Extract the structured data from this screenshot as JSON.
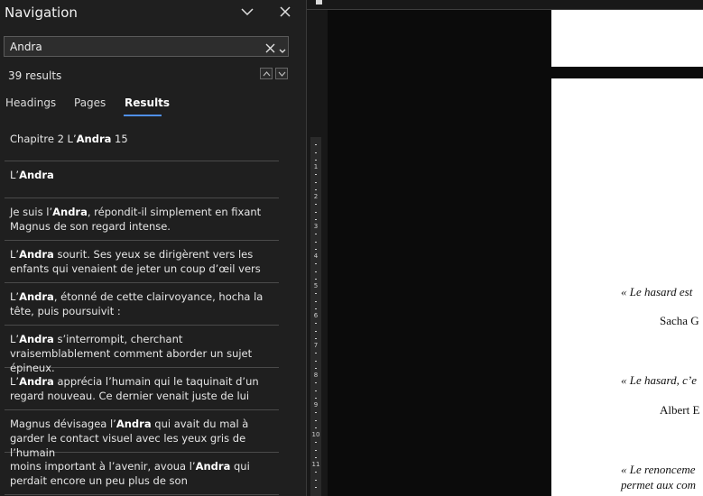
{
  "navigation": {
    "title": "Navigation",
    "search_value": "Andra",
    "results_count": "39 results",
    "tabs": [
      {
        "label": "Headings",
        "active": false
      },
      {
        "label": "Pages",
        "active": false
      },
      {
        "label": "Results",
        "active": true
      }
    ],
    "results": [
      {
        "before": "Chapitre 2 L’",
        "term": "Andra",
        "after": " 15"
      },
      {
        "before": "L’",
        "term": "Andra",
        "after": ""
      },
      {
        "before": "Je suis l’",
        "term": "Andra",
        "after": ", répondit-il simplement en fixant Magnus de son regard intense."
      },
      {
        "before": "L’",
        "term": "Andra",
        "after": " sourit. Ses yeux se dirigèrent vers les enfants qui venaient de jeter un coup d’œil vers"
      },
      {
        "before": "L’",
        "term": "Andra",
        "after": ", étonné de cette clairvoyance, hocha la tête, puis poursuivit :"
      },
      {
        "before": "L’",
        "term": "Andra",
        "after": " s’interrompit, cherchant vraisemblablement comment aborder un sujet épineux."
      },
      {
        "before": "L’",
        "term": "Andra",
        "after": " apprécia l’humain qui le taquinait d’un regard nouveau. Ce dernier venait juste de lui"
      },
      {
        "before": "Magnus dévisagea l’",
        "term": "Andra",
        "after": " qui avait du mal à garder le contact visuel avec les yeux gris de l’humain"
      },
      {
        "before": "moins important à l’avenir, avoua l’",
        "term": "Andra",
        "after": " qui perdait encore un peu plus de son"
      }
    ]
  },
  "ruler": {
    "numbers": [
      "1",
      "2",
      "3",
      "4",
      "5",
      "6",
      "7",
      "8",
      "9",
      "10",
      "11"
    ]
  },
  "document": {
    "quote1": "« Le hasard est",
    "author1": "Sacha G",
    "quote2": "« Le hasard, c’e",
    "author2": "Albert E",
    "quote3_line1": "« Le renonceme",
    "quote3_line2": "permet aux com"
  },
  "colors": {
    "pane_bg": "#1f1f1f",
    "accent": "#4f8fe8",
    "workspace_bg": "#0b0b0b"
  }
}
